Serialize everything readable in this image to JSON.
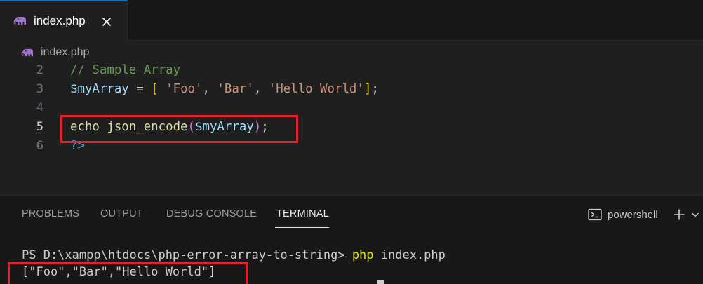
{
  "tab": {
    "label": "index.php",
    "close_glyph": "✕"
  },
  "breadcrumb": {
    "label": "index.php"
  },
  "editor": {
    "lines": [
      {
        "number": "2",
        "comment": "// Sample Array"
      },
      {
        "number": "3",
        "var": "$myArray",
        "op": " = ",
        "open": "[",
        "s1": " 'Foo'",
        "c1": ", ",
        "s2": "'Bar'",
        "c2": ", ",
        "s3": "'Hello World'",
        "close": "]",
        "semi": ";"
      },
      {
        "number": "4"
      },
      {
        "number": "5",
        "kw": "echo ",
        "fn": "json_encode",
        "open": "(",
        "var": "$myArray",
        "close": ")",
        "semi": ";"
      },
      {
        "number": "6",
        "tag": "?>"
      }
    ]
  },
  "panel": {
    "tabs": [
      "PROBLEMS",
      "OUTPUT",
      "DEBUG CONSOLE",
      "TERMINAL"
    ],
    "active_tab": "TERMINAL",
    "shell": "powershell"
  },
  "terminal": {
    "prompt": "PS D:\\xampp\\htdocs\\php-error-array-to-string> ",
    "command": "php",
    "args": " index.php",
    "output": "[\"Foo\",\"Bar\",\"Hello World\"]"
  },
  "colors": {
    "accent": "#0078d4",
    "highlight": "#e0232b",
    "php_icon": "#a074c4"
  }
}
